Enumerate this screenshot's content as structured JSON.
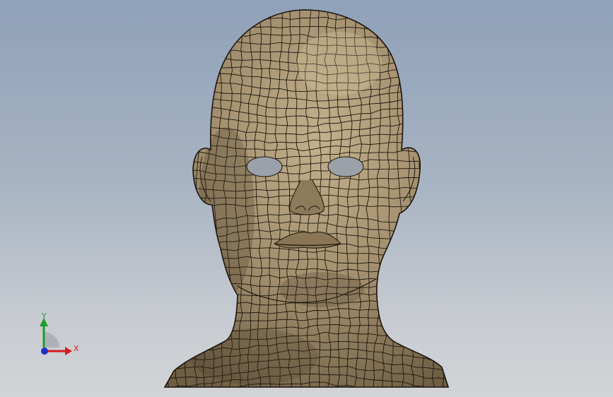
{
  "viewport": {
    "background_top": "#8fa1b9",
    "background_bottom": "#d2d4d7"
  },
  "model": {
    "surface_color": "#a08c6c",
    "mesh_line_color": "#1c160e",
    "eye_color": "#9aa1a8"
  },
  "triad": {
    "x_label": "X",
    "y_label": "Y",
    "x_color": "#d21e1e",
    "y_color": "#1e9b2c",
    "z_color": "#1e2ec8"
  }
}
